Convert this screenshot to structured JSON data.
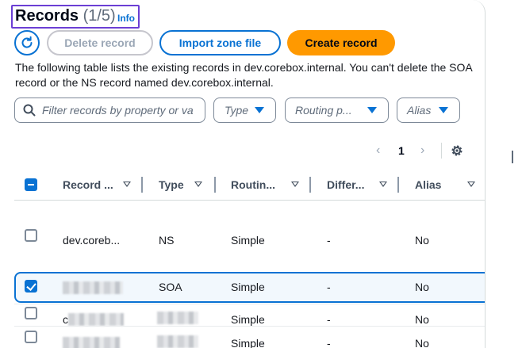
{
  "header": {
    "title": "Records",
    "count": "(1/5)",
    "info": "Info"
  },
  "toolbar": {
    "refresh_icon": "refresh-icon",
    "delete_label": "Delete record",
    "import_label": "Import zone file",
    "create_label": "Create record"
  },
  "description": "The following table lists the existing records in dev.corebox.internal. You can't delete the SOA record or the NS record named dev.corebox.internal.",
  "filters": {
    "search_placeholder": "Filter records by property or va",
    "type_placeholder": "Type",
    "routing_placeholder": "Routing p...",
    "alias_placeholder": "Alias"
  },
  "pagination": {
    "current_page": "1"
  },
  "table": {
    "columns": [
      "Record ...",
      "Type",
      "Routin...",
      "Differ...",
      "Alias"
    ],
    "rows": [
      {
        "name": "dev.coreb...",
        "type": "NS",
        "routing": "Simple",
        "differ": "-",
        "alias": "No",
        "selected": false,
        "name_redacted": false,
        "type_redacted": false
      },
      {
        "name": "",
        "type": "SOA",
        "routing": "Simple",
        "differ": "-",
        "alias": "No",
        "selected": true,
        "name_redacted": true,
        "type_redacted": false
      },
      {
        "name": "c",
        "type": "",
        "routing": "Simple",
        "differ": "-",
        "alias": "No",
        "selected": false,
        "name_redacted": true,
        "type_redacted": true
      },
      {
        "name": "",
        "type": "",
        "routing": "Simple",
        "differ": "-",
        "alias": "No",
        "selected": false,
        "name_redacted": true,
        "type_redacted": true
      }
    ]
  },
  "colors": {
    "accent": "#0972d3",
    "primary_button": "#ff9900",
    "highlight_border": "#6b3fd4"
  }
}
